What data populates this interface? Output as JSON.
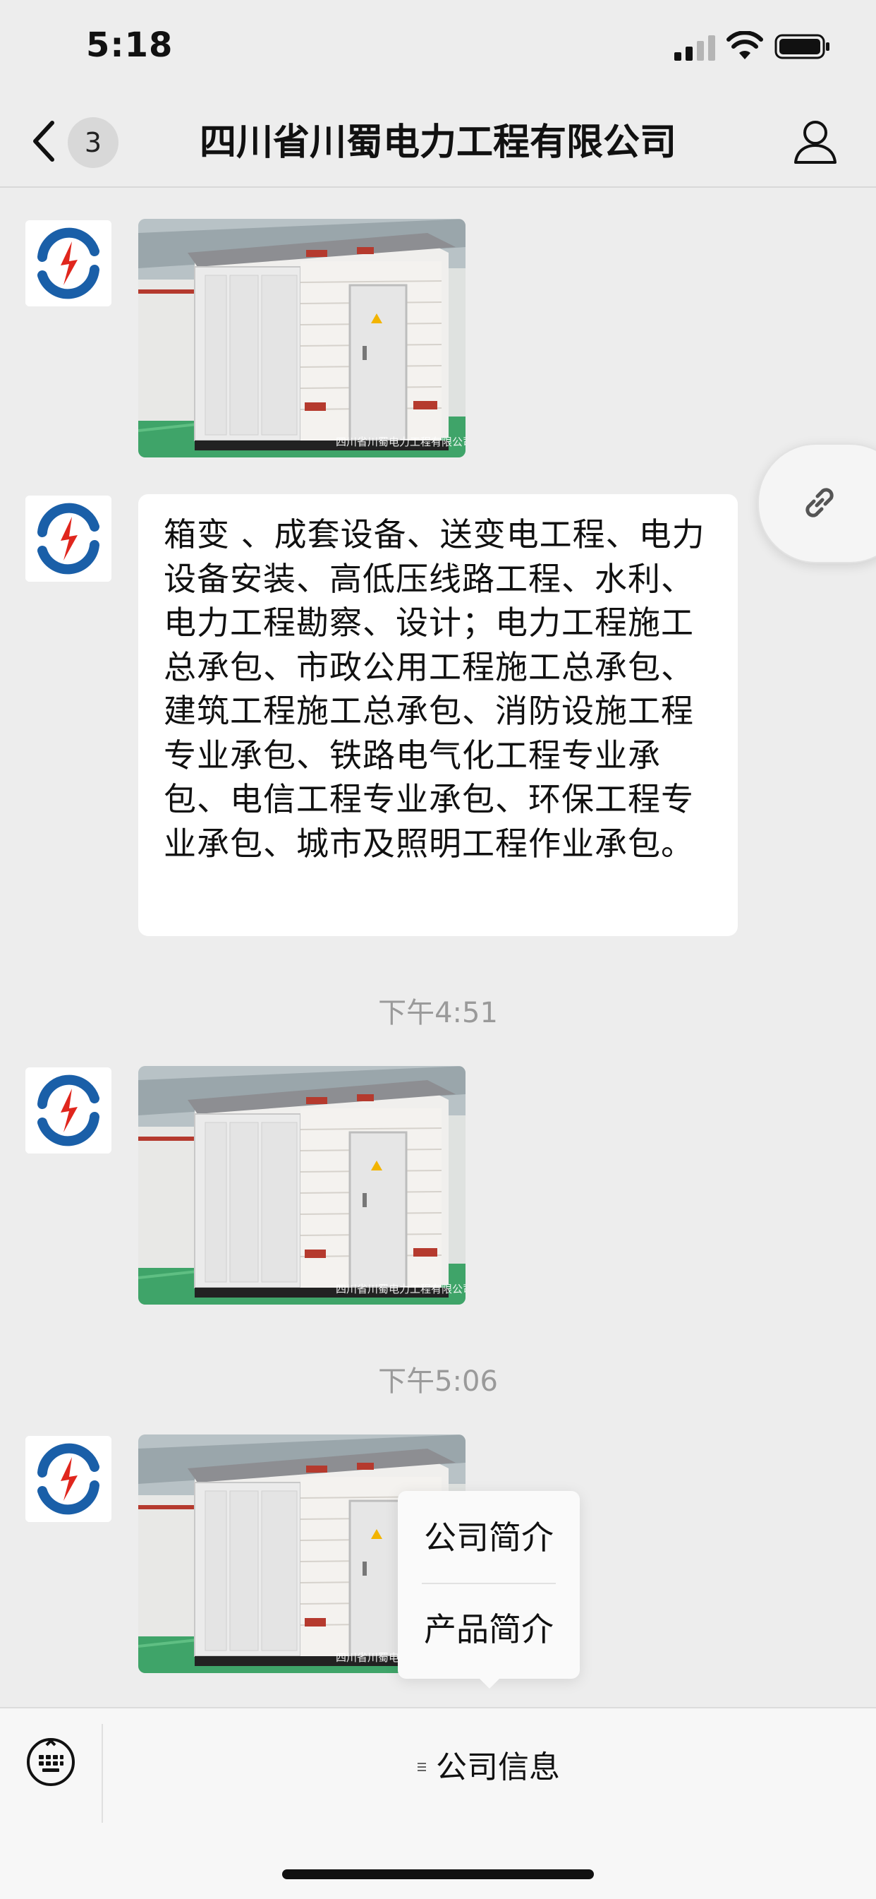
{
  "status_bar": {
    "time": "5:18"
  },
  "nav": {
    "back_label": "",
    "unread_count": "3",
    "title": "四川省川蜀电力工程有限公司"
  },
  "messages": {
    "image_watermark": "四川省川蜀电力工程有限公司",
    "business_scope_text": "箱变 、成套设备、送变电工程、电力设备安装、高低压线路工程、水利、电力工程勘察、设计；电力工程施工总承包、市政公用工程施工总承包、建筑工程施工总承包、消防设施工程专业承包、铁路电气化工程专业承包、电信工程专业承包、环保工程专业承包、城市及照明工程作业承包。",
    "timestamps": [
      "下午4:51",
      "下午5:06"
    ]
  },
  "popup_menu": {
    "items": [
      "公司简介",
      "产品简介"
    ]
  },
  "bottom_bar": {
    "menu_label": "公司信息"
  },
  "colors": {
    "background": "#ededed",
    "bubble": "#ffffff",
    "logo_blue": "#1a5fa8",
    "logo_red": "#e0261d"
  }
}
